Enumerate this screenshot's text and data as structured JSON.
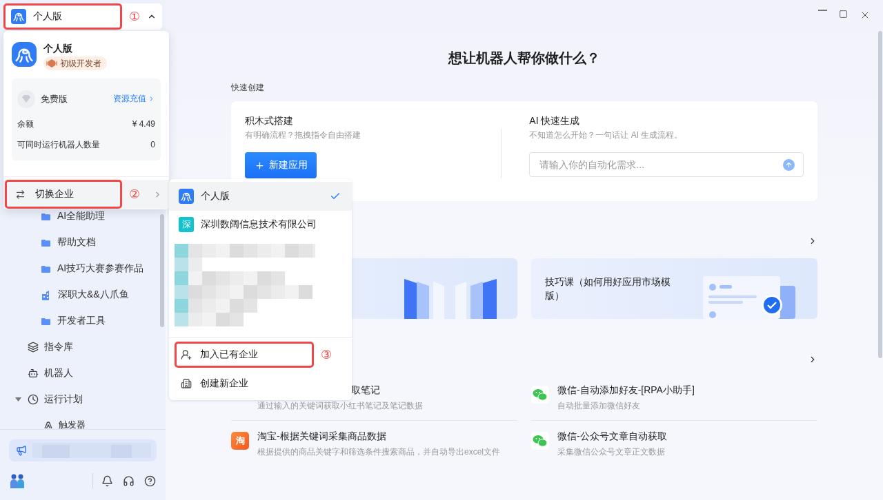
{
  "sidebar": {
    "switcher": {
      "label": "个人版",
      "highlighted": true,
      "annotation": "①",
      "expanded": true
    },
    "folders": [
      {
        "label": "AI全能助理",
        "kind": "folder"
      },
      {
        "label": "帮助文档",
        "kind": "folder"
      },
      {
        "label": "AI技巧大赛参赛作品",
        "kind": "folder"
      },
      {
        "label": "深职大&&八爪鱼",
        "kind": "shared"
      },
      {
        "label": "开发者工具",
        "kind": "folder"
      }
    ],
    "nav": [
      {
        "label": "指令库",
        "kind": "commands"
      },
      {
        "label": "机器人",
        "kind": "robot"
      },
      {
        "label": "运行计划",
        "kind": "schedule",
        "expanded": true,
        "children": [
          {
            "label": "触发器",
            "kind": "trigger"
          }
        ]
      }
    ]
  },
  "account_panel": {
    "name": "个人版",
    "badge": "初级开发者",
    "plan": "免费版",
    "recharge_link": "资源充值",
    "stats": [
      {
        "label": "余额",
        "value": "¥ 4.49"
      },
      {
        "label": "可同时运行机器人数量",
        "value": "0"
      }
    ],
    "switch_item": {
      "label": "切换企业",
      "highlighted": true,
      "annotation": "②"
    }
  },
  "enterprise_menu": {
    "items": [
      {
        "label": "个人版",
        "kind": "personal",
        "selected": true
      },
      {
        "label": "深圳数阔信息技术有限公司",
        "kind": "company",
        "icon_text": "深",
        "selected": false
      }
    ],
    "actions": [
      {
        "label": "加入已有企业",
        "kind": "join",
        "highlighted": true,
        "annotation": "③"
      },
      {
        "label": "创建新企业",
        "kind": "create",
        "highlighted": false
      }
    ]
  },
  "main": {
    "title": "想让机器人帮你做什么？",
    "quick_create": {
      "heading": "快速创建",
      "manual": {
        "title": "积木式搭建",
        "description": "有明确流程？拖拽指令自由搭建",
        "button": "新建应用"
      },
      "ai": {
        "title": "AI 快速生成",
        "description": "不知道怎么开始？一句话让 AI 生成流程。",
        "placeholder": "请输入你的自动化需求..."
      }
    },
    "banners": [
      {
        "kind": "books"
      },
      {
        "kind": "template",
        "title": "技巧课（如何用好应用市场模版）"
      }
    ],
    "templates": [
      {
        "kind": "covered",
        "title": "取笔记",
        "description": "通过输入的关键词获取小红书笔记及笔记数据"
      },
      {
        "kind": "wechat",
        "title": "微信-自动添加好友-[RPA小助手]",
        "description": "自动批量添加微信好友"
      },
      {
        "kind": "taobao",
        "icon_text": "淘",
        "title": "淘宝-根据关键词采集商品数据",
        "description": "根据提供的商品关键字和筛选条件搜索商品，并自动导出excel文件"
      },
      {
        "kind": "wechat",
        "title": "微信-公众号文章自动获取",
        "description": "采集微信公众号文章正文数据"
      }
    ]
  }
}
